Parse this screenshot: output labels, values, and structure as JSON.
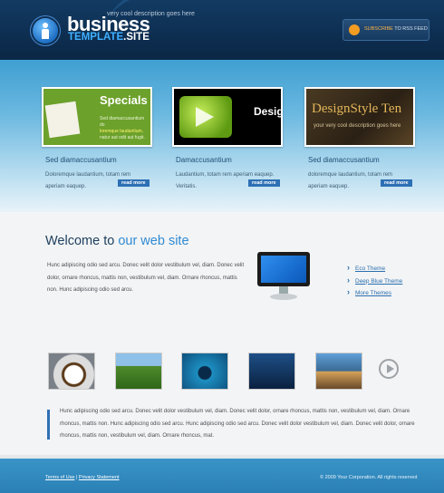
{
  "header": {
    "tagline": "very cool description goes here",
    "brand_main": "business",
    "brand_sub": "TEMPLATE",
    "brand_dot": ".SITE",
    "rss_label_a": "SUBSCRIBE",
    "rss_label_b": "TO RSS FEED"
  },
  "features": [
    {
      "thumb_title": "Specials",
      "thumb_text_a": "Sed diamaccusantium do",
      "thumb_text_b": "loremque laudantium,",
      "thumb_text_c": "natur aut odit aut fugit.",
      "title": "Sed diamaccusantium",
      "text": "Doloremque laudantium, totam rem aperiam eaquep.",
      "more": "read more"
    },
    {
      "thumb_title": "Desig",
      "title": "Damaccusantium",
      "text": "Laudantium, totam rem aperiam eaquep. Veritatis.",
      "more": "read more"
    },
    {
      "thumb_title": "DesignStyle Ten",
      "thumb_sub": "your very cool description goes here",
      "title": "Sed diamaccusantium",
      "text": "doloremque laudantium, totam rem aperiam eaquep.",
      "more": "read more"
    }
  ],
  "welcome": {
    "title_a": "Welcome to",
    "title_b": " our web site",
    "text": "Hunc adipiscing odio sed arcu. Donec velit dolor vestibulum vel, diam. Donec velit dolor, ornare rhoncus, mattis non, vestibulum vel, diam. Ornare rhoncus, mattis non. Hunc adipiscing odio sed arcu."
  },
  "themes": [
    "Eco Theme",
    "Deep Blue Theme",
    "More Themes"
  ],
  "quote": "Hunc adipiscing odio sed arcu. Donec velit dolor vestibulum vel, diam. Donec velit dolor, ornare rhoncus, mattis non, vestibulum vel, diam. Ornare rhoncus, mattis non. Hunc adipiscing odio sed arcu. Hunc adipiscing odio sed arcu. Donec velit dolor vestibulum vel, diam. Donec velit dolor, ornare rhoncus, mattis non, vestibulum vel, diam. Ornare rhoncus, mat.",
  "footer": {
    "terms": "Terms of Use",
    "separator": "|",
    "privacy": "Privacy Statement",
    "copyright": "© 2009 Your Corporation. All rights reserved"
  },
  "icons": {
    "logo": "person-icon",
    "rss": "rss-icon",
    "gallery_next": "play-icon"
  },
  "colors": {
    "header_bg": "#0e2f52",
    "accent": "#2e8ad3",
    "footer_bg": "#2a80b5"
  }
}
